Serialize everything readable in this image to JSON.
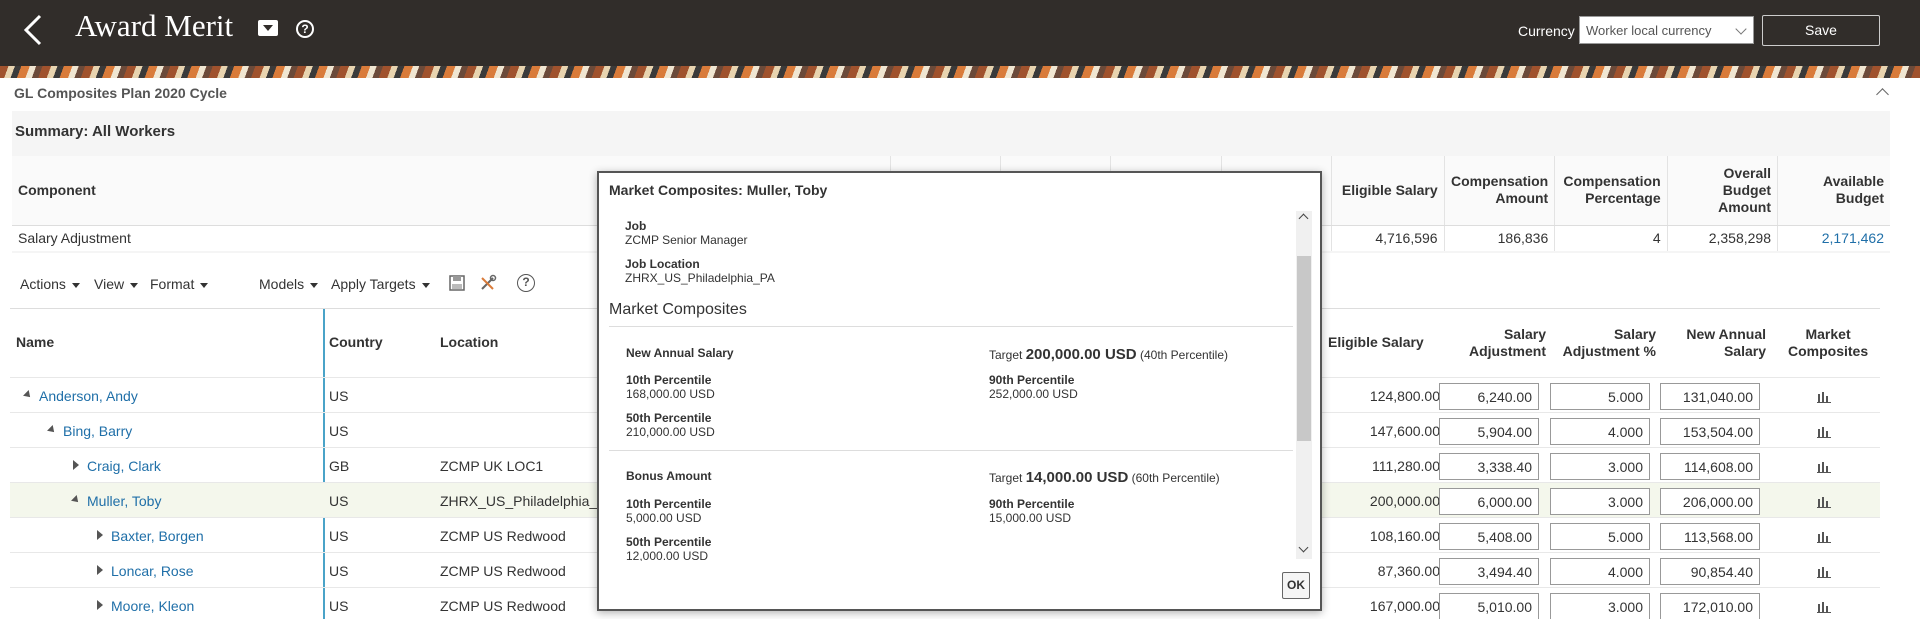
{
  "header": {
    "title": "Award Merit",
    "currency_label": "Currency",
    "currency_value": "Worker local currency",
    "save_label": "Save"
  },
  "plan_title": "GL Composites Plan 2020 Cycle",
  "summary": {
    "title": "Summary: All Workers",
    "columns": [
      "Component",
      "Eligible Salary",
      "Compensation Amount",
      "Compensation Percentage",
      "Overall Budget Amount",
      "Available Budget"
    ],
    "row": {
      "component": "Salary Adjustment",
      "eligible_salary": "4,716,596",
      "comp_amount": "186,836",
      "comp_pct": "4",
      "overall_budget": "2,358,298",
      "available_budget": "2,171,462"
    }
  },
  "toolbar": {
    "actions": "Actions",
    "view": "View",
    "format": "Format",
    "models": "Models",
    "apply_targets": "Apply Targets"
  },
  "table": {
    "columns": {
      "name": "Name",
      "country": "Country",
      "location": "Location",
      "eligible_salary": "Eligible Salary",
      "salary_adjustment": "Salary Adjustment",
      "salary_adjustment_pct": "Salary Adjustment %",
      "new_annual_salary": "New Annual Salary",
      "market_composites": "Market Composites"
    },
    "rows": [
      {
        "name": "Anderson, Andy",
        "country": "US",
        "location": "",
        "eligible": "124,800.00",
        "adj": "6,240.00",
        "pct": "5.000",
        "new": "131,040.00"
      },
      {
        "name": "Bing, Barry",
        "country": "US",
        "location": "",
        "eligible": "147,600.00",
        "adj": "5,904.00",
        "pct": "4.000",
        "new": "153,504.00"
      },
      {
        "name": "Craig, Clark",
        "country": "GB",
        "location": "ZCMP UK LOC1",
        "eligible": "111,280.00",
        "adj": "3,338.40",
        "pct": "3.000",
        "new": "114,608.00"
      },
      {
        "name": "Muller, Toby",
        "country": "US",
        "location": "ZHRX_US_Philadelphia_P",
        "eligible": "200,000.00",
        "adj": "6,000.00",
        "pct": "3.000",
        "new": "206,000.00"
      },
      {
        "name": "Baxter, Borgen",
        "country": "US",
        "location": "ZCMP US Redwood",
        "eligible": "108,160.00",
        "adj": "5,408.00",
        "pct": "5.000",
        "new": "113,568.00"
      },
      {
        "name": "Loncar, Rose",
        "country": "US",
        "location": "ZCMP US Redwood",
        "eligible": "87,360.00",
        "adj": "3,494.40",
        "pct": "4.000",
        "new": "90,854.40"
      },
      {
        "name": "Moore, Kleon",
        "country": "US",
        "location": "ZCMP US Redwood",
        "eligible": "167,000.00",
        "adj": "5,010.00",
        "pct": "3.000",
        "new": "172,010.00"
      }
    ]
  },
  "modal": {
    "title": "Market Composites: Muller, Toby",
    "job_label": "Job",
    "job_value": "ZCMP Senior Manager",
    "location_label": "Job Location",
    "location_value": "ZHRX_US_Philadelphia_PA",
    "section_title": "Market Composites",
    "salary": {
      "label": "New Annual Salary",
      "target_label": "Target",
      "target_value": "200,000.00 USD",
      "target_pct": "(40th Percentile)",
      "p10_label": "10th Percentile",
      "p10_value": "168,000.00 USD",
      "p50_label": "50th Percentile",
      "p50_value": "210,000.00 USD",
      "p90_label": "90th Percentile",
      "p90_value": "252,000.00 USD"
    },
    "bonus": {
      "label": "Bonus Amount",
      "target_label": "Target",
      "target_value": "14,000.00 USD",
      "target_pct": "(60th Percentile)",
      "p10_label": "10th Percentile",
      "p10_value": "5,000.00 USD",
      "p50_label": "50th Percentile",
      "p50_value": "12,000.00 USD",
      "p90_label": "90th Percentile",
      "p90_value": "15,000.00 USD"
    },
    "ok_label": "OK"
  }
}
